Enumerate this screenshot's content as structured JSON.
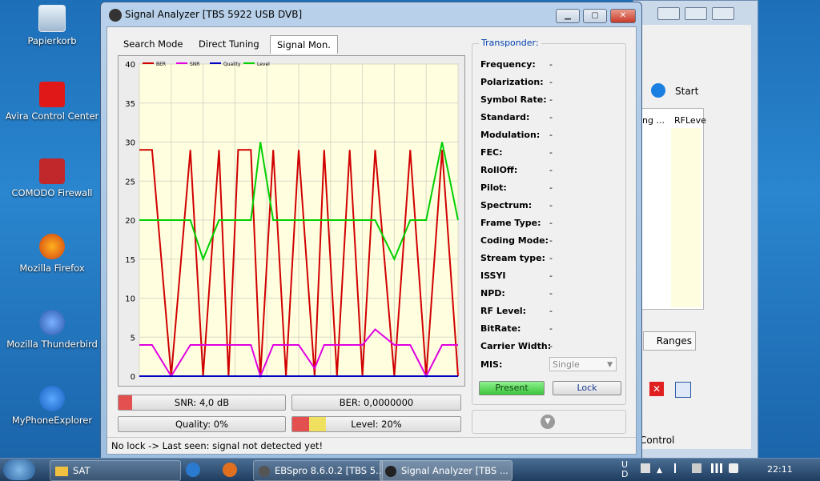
{
  "desktop": {
    "icons": [
      {
        "label": "Papierkorb",
        "icon": "recycle-bin-icon"
      },
      {
        "label": "Avira Control Center",
        "icon": "avira-icon"
      },
      {
        "label": "COMODO Firewall",
        "icon": "comodo-icon"
      },
      {
        "label": "Mozilla Firefox",
        "icon": "firefox-icon"
      },
      {
        "label": "Mozilla Thunderbird",
        "icon": "thunderbird-icon"
      },
      {
        "label": "MyPhoneExplorer",
        "icon": "myphoneexplorer-icon"
      }
    ]
  },
  "background_window": {
    "start_label": "Start",
    "col1": "ng ...",
    "col2": "RFLeve",
    "ranges_label": "Ranges",
    "control_label": "Control"
  },
  "window": {
    "title": "Signal Analyzer [TBS 5922 USB DVB]",
    "tabs": [
      "Search Mode",
      "Direct Tuning",
      "Signal Mon."
    ],
    "active_tab": "Signal Mon.",
    "status": "No lock -> Last seen: signal not detected yet!"
  },
  "meters": {
    "snr": {
      "label": "SNR: 4,0 dB",
      "fraction": 0.08
    },
    "ber": {
      "label": "BER: 0,0000000"
    },
    "quality": {
      "label": "Quality: 0%"
    },
    "level": {
      "label": "Level: 20%",
      "fraction": 0.2
    }
  },
  "transponder": {
    "title": "Transponder:",
    "fields": [
      {
        "label": "Frequency:",
        "value": "-"
      },
      {
        "label": "Polarization:",
        "value": "-"
      },
      {
        "label": "Symbol Rate:",
        "value": "-"
      },
      {
        "label": "Standard:",
        "value": "-"
      },
      {
        "label": "Modulation:",
        "value": "-"
      },
      {
        "label": "FEC:",
        "value": "-"
      },
      {
        "label": "RollOff:",
        "value": "-"
      },
      {
        "label": "Pilot:",
        "value": "-"
      },
      {
        "label": "Spectrum:",
        "value": "-"
      },
      {
        "label": "Frame Type:",
        "value": "-"
      },
      {
        "label": "Coding Mode:",
        "value": "-"
      },
      {
        "label": "Stream type:",
        "value": "-"
      },
      {
        "label": "ISSYI",
        "value": "-"
      },
      {
        "label": "NPD:",
        "value": "-"
      },
      {
        "label": "RF Level:",
        "value": "-"
      },
      {
        "label": "BitRate:",
        "value": "-"
      },
      {
        "label": "Carrier Width:",
        "value": "-"
      }
    ],
    "mis_label": "MIS:",
    "mis_value": "Single",
    "present_label": "Present",
    "lock_label": "Lock"
  },
  "chart_data": {
    "type": "line",
    "ylim": [
      0,
      40
    ],
    "yticks": [
      "0",
      "5",
      "10",
      "15",
      "20",
      "25",
      "30",
      "35",
      "40"
    ],
    "legend": [
      "BER",
      "SNR",
      "Quality",
      "Level"
    ],
    "grid": true,
    "colors": {
      "BER": "#d00000",
      "SNR": "#e000e0",
      "Quality": "#0000c0",
      "Level": "#00d000"
    },
    "x": [
      0,
      4,
      10,
      16,
      20,
      25,
      28,
      31,
      35,
      38,
      42,
      46,
      50,
      55,
      58,
      62,
      66,
      70,
      74,
      80,
      85,
      90,
      95,
      100
    ],
    "series": [
      {
        "name": "BER",
        "values": [
          29,
          29,
          0,
          29,
          0,
          29,
          0,
          29,
          29,
          0,
          29,
          0,
          29,
          0,
          29,
          0,
          29,
          0,
          29,
          0,
          29,
          0,
          29,
          0
        ]
      },
      {
        "name": "SNR",
        "values": [
          4,
          4,
          0,
          4,
          4,
          4,
          4,
          4,
          4,
          0,
          4,
          4,
          4,
          1,
          4,
          4,
          4,
          4,
          6,
          4,
          4,
          0,
          4,
          4
        ]
      },
      {
        "name": "Quality",
        "values": [
          0,
          0,
          0,
          0,
          0,
          0,
          0,
          0,
          0,
          0,
          0,
          0,
          0,
          0,
          0,
          0,
          0,
          0,
          0,
          0,
          0,
          0,
          0,
          0
        ]
      },
      {
        "name": "Level",
        "values": [
          20,
          20,
          20,
          20,
          15,
          20,
          20,
          20,
          20,
          30,
          20,
          20,
          20,
          20,
          20,
          20,
          20,
          20,
          20,
          15,
          20,
          20,
          30,
          20
        ]
      }
    ]
  },
  "taskbar": {
    "items": [
      "SAT",
      "EBSpro 8.6.0.2 [TBS 5...",
      "Signal Analyzer [TBS ..."
    ],
    "clock": "22:11",
    "lang1": "U",
    "lang2": "D"
  }
}
